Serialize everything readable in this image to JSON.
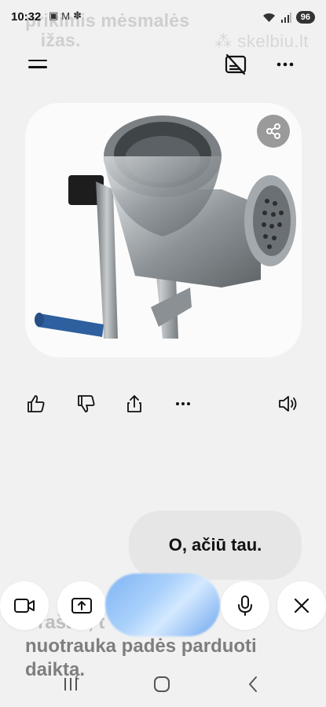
{
  "background_text_top": "prikimis mėsmalės\n   ižas.",
  "watermark": "skelbiu.lt",
  "status": {
    "time": "10:32",
    "battery": "96"
  },
  "toolbar": {
    "menu_icon": "hamburger-icon",
    "no_subtitles_icon": "captions-off-icon",
    "more_icon": "more-dots-icon"
  },
  "image": {
    "subject": "meat-grinder-image",
    "share_icon": "share-icon"
  },
  "actions": {
    "like": "thumbs-up-icon",
    "dislike": "thumbs-down-icon",
    "share": "share-icon",
    "more": "more-dots-icon",
    "read_aloud": "speaker-icon"
  },
  "user_message": "O, ačiū tau.",
  "background_text_bottom": {
    "line1": "Prašau, t",
    "line2": "nuotrauka padės parduoti",
    "line3": "daiktą."
  },
  "controls": {
    "video": "video-icon",
    "screen_share": "screen-share-icon",
    "mic": "microphone-icon",
    "close": "close-icon"
  },
  "navbar": {
    "recents": "recents-icon",
    "home": "home-icon",
    "back": "back-icon"
  },
  "colors": {
    "background": "#f1f1f1",
    "bubble": "#e6e6e6",
    "accent_orb": "#7fb4f3"
  }
}
